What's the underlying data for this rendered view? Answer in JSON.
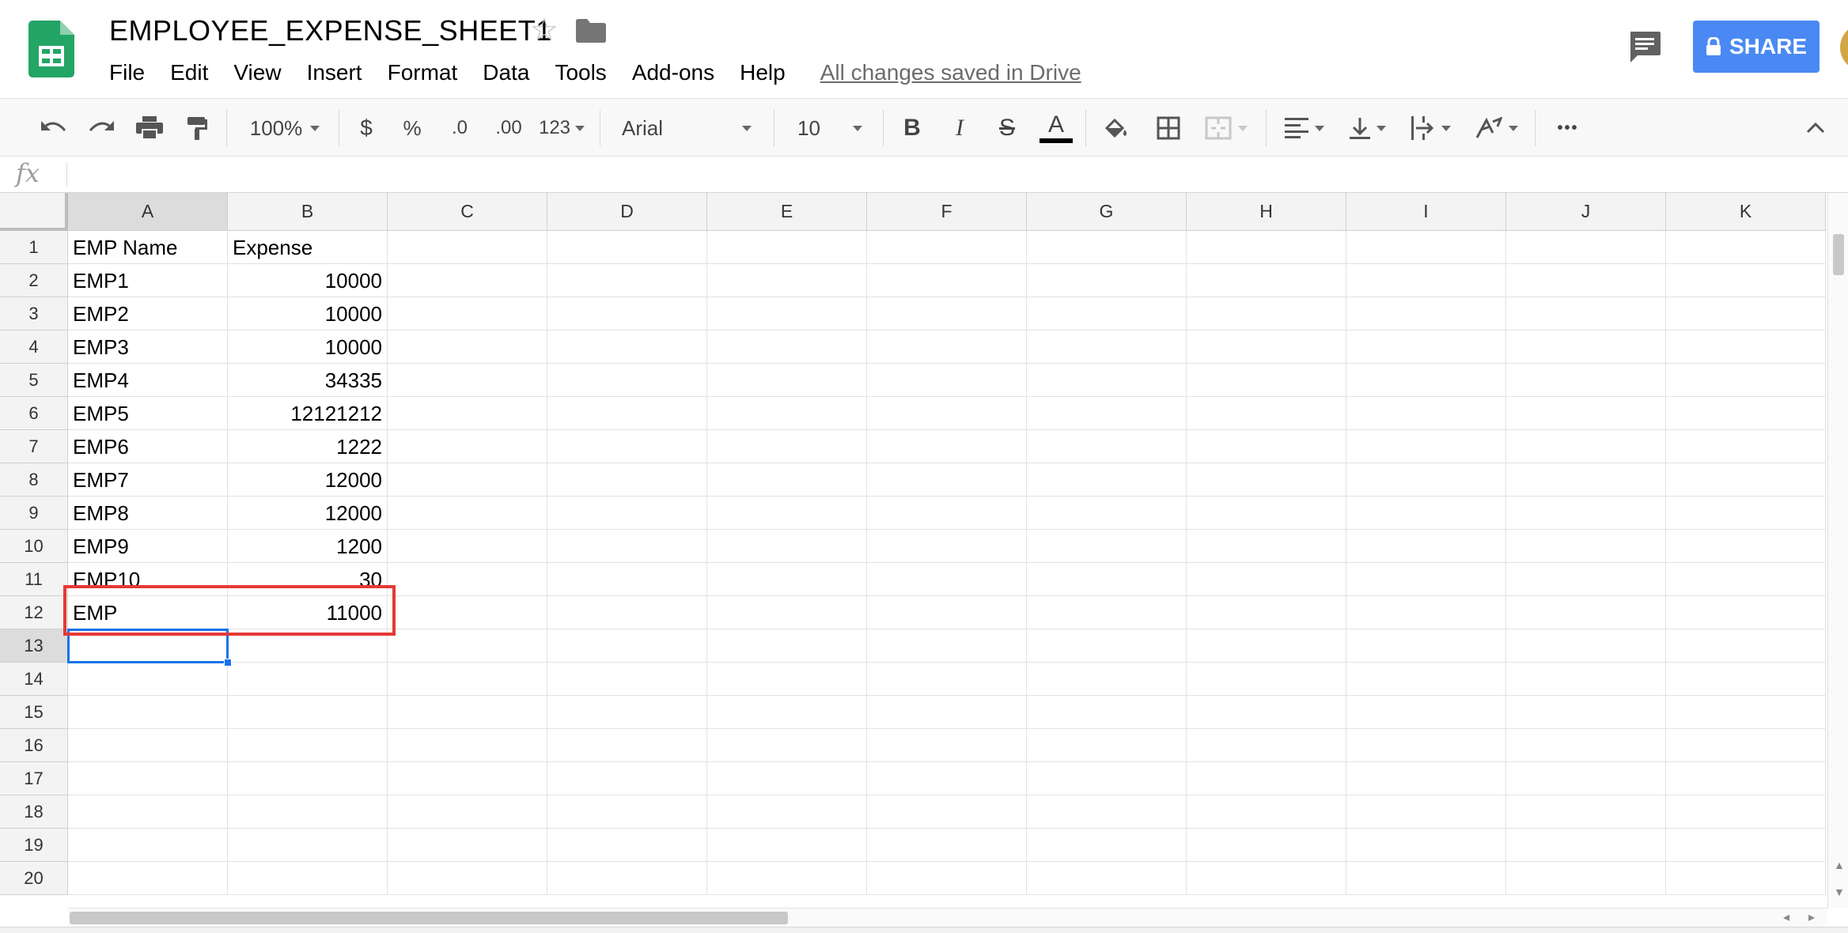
{
  "header": {
    "title": "EMPLOYEE_EXPENSE_SHEET1",
    "saved_status": "All changes saved in Drive",
    "share_label": "SHARE"
  },
  "menu": [
    "File",
    "Edit",
    "View",
    "Insert",
    "Format",
    "Data",
    "Tools",
    "Add-ons",
    "Help"
  ],
  "toolbar": {
    "zoom": "100%",
    "currency": "$",
    "percent": "%",
    "decrease_decimal": ".0",
    "increase_decimal": ".00",
    "more_formats": "123",
    "font": "Arial",
    "font_size": "10",
    "bold": "B",
    "italic": "I",
    "strike": "S",
    "text_color": "A",
    "more": "•••"
  },
  "formula_bar": {
    "icon": "fx",
    "value": ""
  },
  "grid": {
    "columns": [
      "A",
      "B",
      "C",
      "D",
      "E",
      "F",
      "G",
      "H",
      "I",
      "J",
      "K"
    ],
    "rows": [
      "1",
      "2",
      "3",
      "4",
      "5",
      "6",
      "7",
      "8",
      "9",
      "10",
      "11",
      "12",
      "13",
      "14",
      "15",
      "16",
      "17",
      "18",
      "19",
      "20"
    ],
    "cells": [
      [
        "EMP Name",
        "Expense"
      ],
      [
        "EMP1",
        "10000"
      ],
      [
        "EMP2",
        "10000"
      ],
      [
        "EMP3",
        "10000"
      ],
      [
        "EMP4",
        "34335"
      ],
      [
        "EMP5",
        "12121212"
      ],
      [
        "EMP6",
        "1222"
      ],
      [
        "EMP7",
        "12000"
      ],
      [
        "EMP8",
        "12000"
      ],
      [
        "EMP9",
        "1200"
      ],
      [
        "EMP10",
        "30"
      ],
      [
        "EMP",
        "11000"
      ]
    ],
    "selected_cell": "A13",
    "highlight_rows": [
      "12"
    ]
  },
  "colors": {
    "share_button": "#4a89f3",
    "selection": "#1a73e8",
    "highlight": "#e53935",
    "logo": "#23a566"
  }
}
